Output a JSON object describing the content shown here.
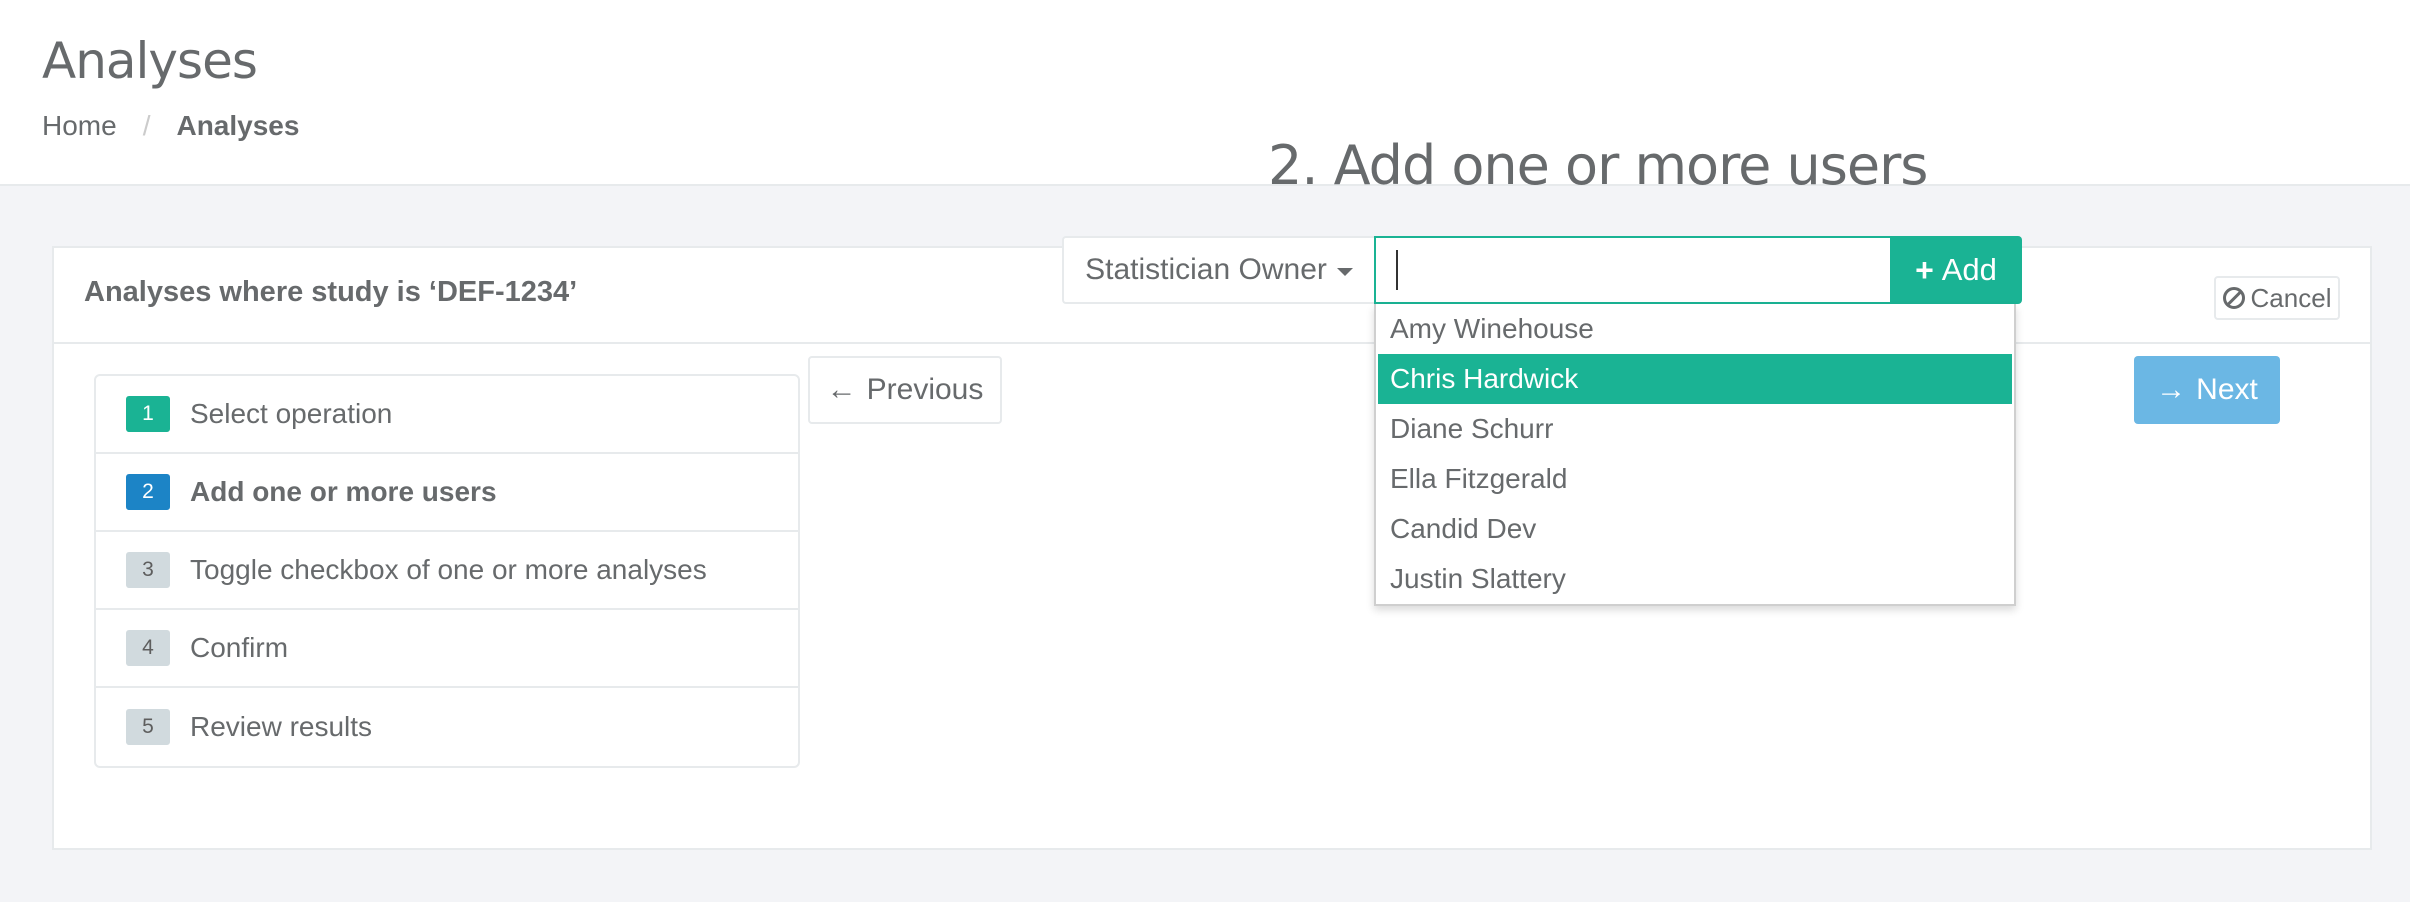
{
  "header": {
    "title": "Analyses",
    "breadcrumb": {
      "home": "Home",
      "separator": "/",
      "current": "Analyses"
    }
  },
  "panel": {
    "title": "Analyses where study is ‘DEF-1234’",
    "cancel_label": "Cancel"
  },
  "steps": [
    {
      "num": "1",
      "label": "Select operation",
      "state": "done"
    },
    {
      "num": "2",
      "label": "Add one or more users",
      "state": "active"
    },
    {
      "num": "3",
      "label": "Toggle checkbox of one or more analyses",
      "state": "pending"
    },
    {
      "num": "4",
      "label": "Confirm",
      "state": "pending"
    },
    {
      "num": "5",
      "label": "Review results",
      "state": "pending"
    }
  ],
  "step_content": {
    "heading": "2. Add one or more users",
    "role_select": "Statistician Owner",
    "user_input_value": "",
    "add_label": "Add",
    "dropdown_options": [
      "Amy Winehouse",
      "Chris Hardwick",
      "Diane Schurr",
      "Ella Fitzgerald",
      "Candid Dev",
      "Justin Slattery"
    ],
    "highlighted_option": "Chris Hardwick"
  },
  "nav": {
    "previous_label": "Previous",
    "next_label": "Next"
  },
  "colors": {
    "primary": "#1ab394",
    "step_active": "#1c84c6",
    "next_button": "#6bb7e4"
  },
  "icons": {
    "cancel": "ban-icon",
    "add": "plus-icon",
    "previous": "arrow-left-icon",
    "next": "arrow-right-icon",
    "role": "caret-down-icon"
  }
}
